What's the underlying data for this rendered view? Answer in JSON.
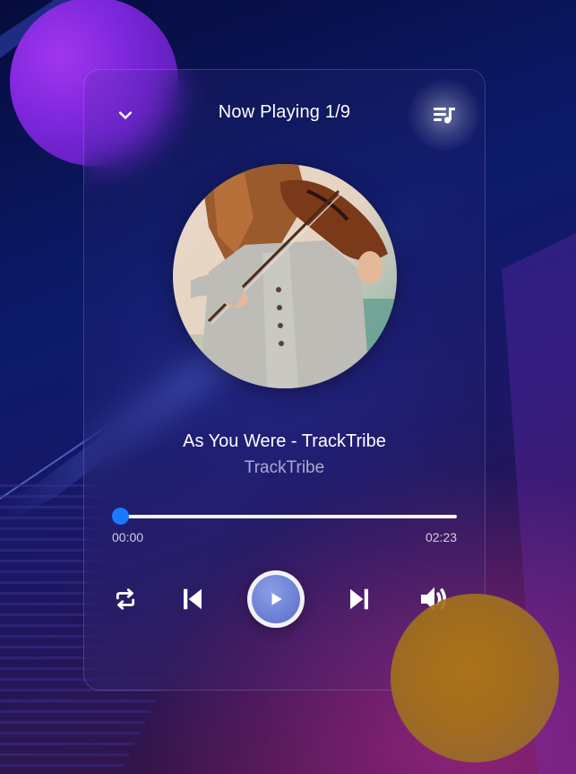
{
  "header": {
    "title": "Now Playing 1/9"
  },
  "track": {
    "title": "As You Were - TrackTribe",
    "artist": "TrackTribe",
    "progress_fraction": 0.0
  },
  "time": {
    "current": "00:00",
    "total": "02:23"
  },
  "icons": {
    "collapse": "chevron-down-icon",
    "playlist": "playlist-music-icon",
    "repeat": "repeat-icon",
    "previous": "skip-previous-icon",
    "play": "play-icon",
    "next": "skip-next-icon",
    "volume": "volume-up-icon"
  },
  "colors": {
    "accent": "#1979ff",
    "play_button": "#6f83d8",
    "blob_purple": "#8a2be2",
    "blob_gold": "#a57318"
  }
}
